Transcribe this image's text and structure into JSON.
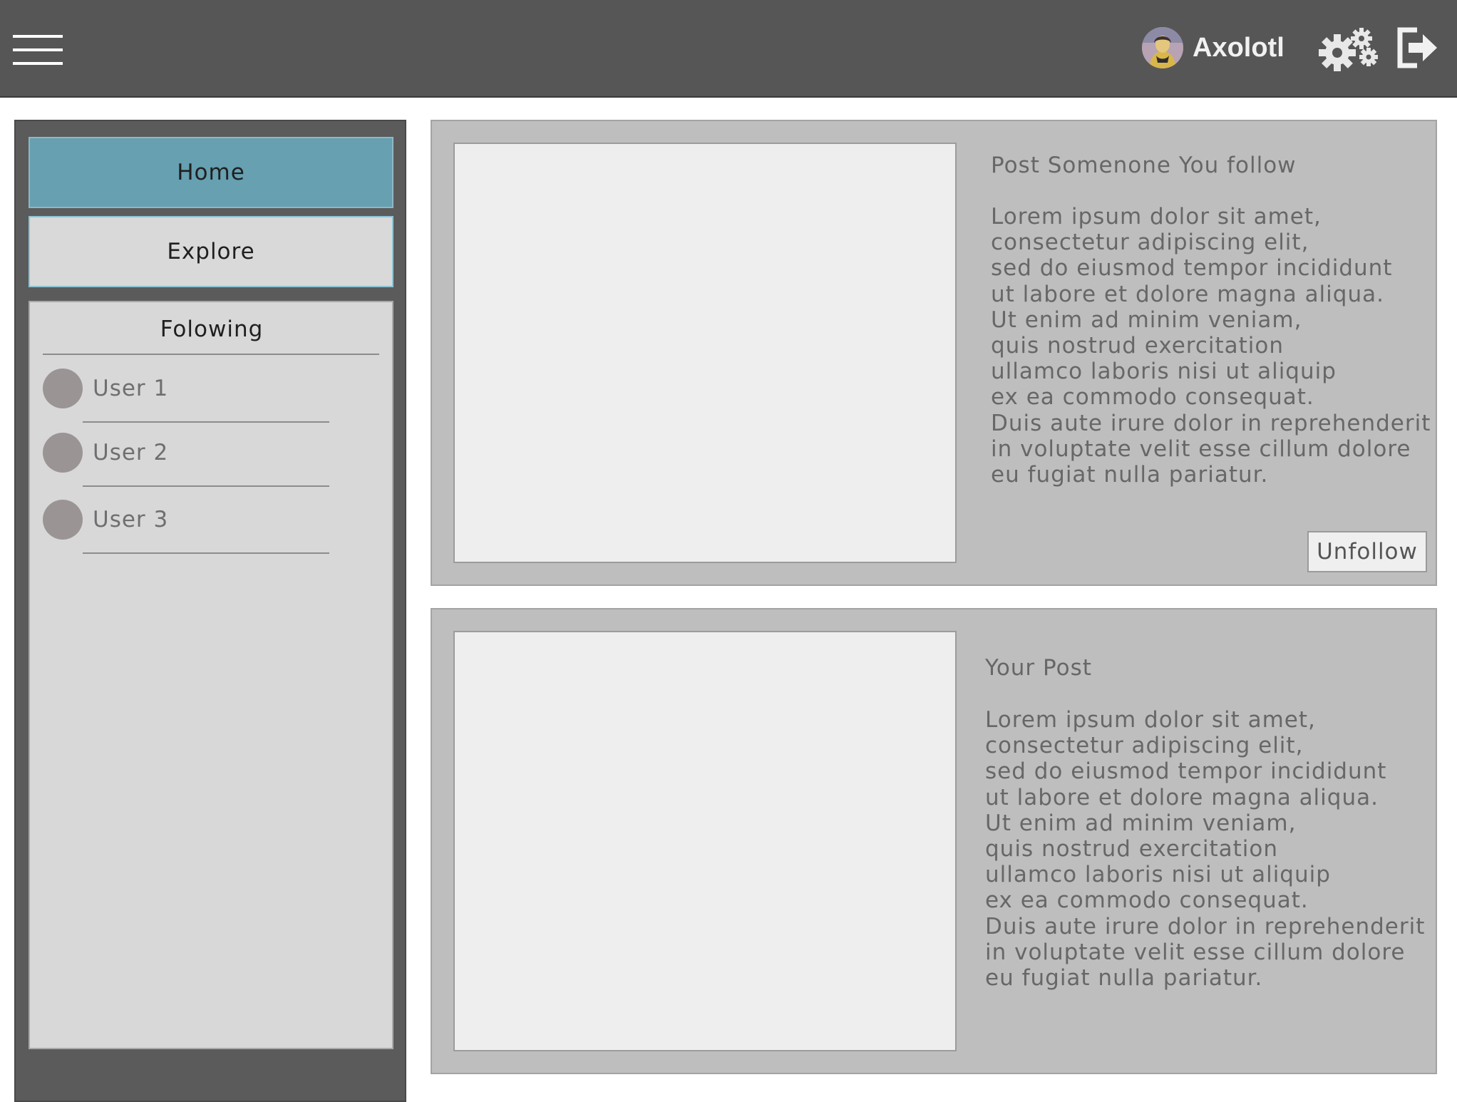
{
  "header": {
    "menu_icon": "hamburger-menu-icon",
    "username": "Axolotl",
    "settings_icon": "gears-icon",
    "logout_icon": "logout-icon"
  },
  "sidebar": {
    "nav": [
      {
        "label": "Home",
        "active": true
      },
      {
        "label": "Explore",
        "active": false
      }
    ],
    "following": {
      "title": "Folowing",
      "users": [
        {
          "name": "User 1"
        },
        {
          "name": "User 2"
        },
        {
          "name": "User 3"
        }
      ]
    }
  },
  "posts": [
    {
      "title": "Post Somenone You follow",
      "body": "Lorem ipsum dolor sit amet,\nconsectetur adipiscing elit,\nsed do eiusmod tempor incididunt\nut labore et dolore magna aliqua.\nUt enim ad minim veniam,\nquis nostrud exercitation\nullamco laboris nisi ut aliquip\nex ea commodo consequat.\nDuis aute irure dolor in reprehenderit\nin voluptate velit esse cillum dolore\neu fugiat nulla pariatur.",
      "action_label": "Unfollow"
    },
    {
      "title": "Your Post",
      "body": "Lorem ipsum dolor sit amet,\nconsectetur adipiscing elit,\nsed do eiusmod tempor incididunt\nut labore et dolore magna aliqua.\nUt enim ad minim veniam,\nquis nostrud exercitation\nullamco laboris nisi ut aliquip\nex ea commodo consequat.\nDuis aute irure dolor in reprehenderit\nin voluptate velit esse cillum dolore\neu fugiat nulla pariatur."
    }
  ],
  "colors": {
    "topbar": "#575657",
    "sidebar": "#5b5b5b",
    "nav_active": "#66a0b1",
    "nav_inactive": "#d9d9d9",
    "post_card": "#bebebe",
    "image_placeholder": "#eeeeee"
  }
}
